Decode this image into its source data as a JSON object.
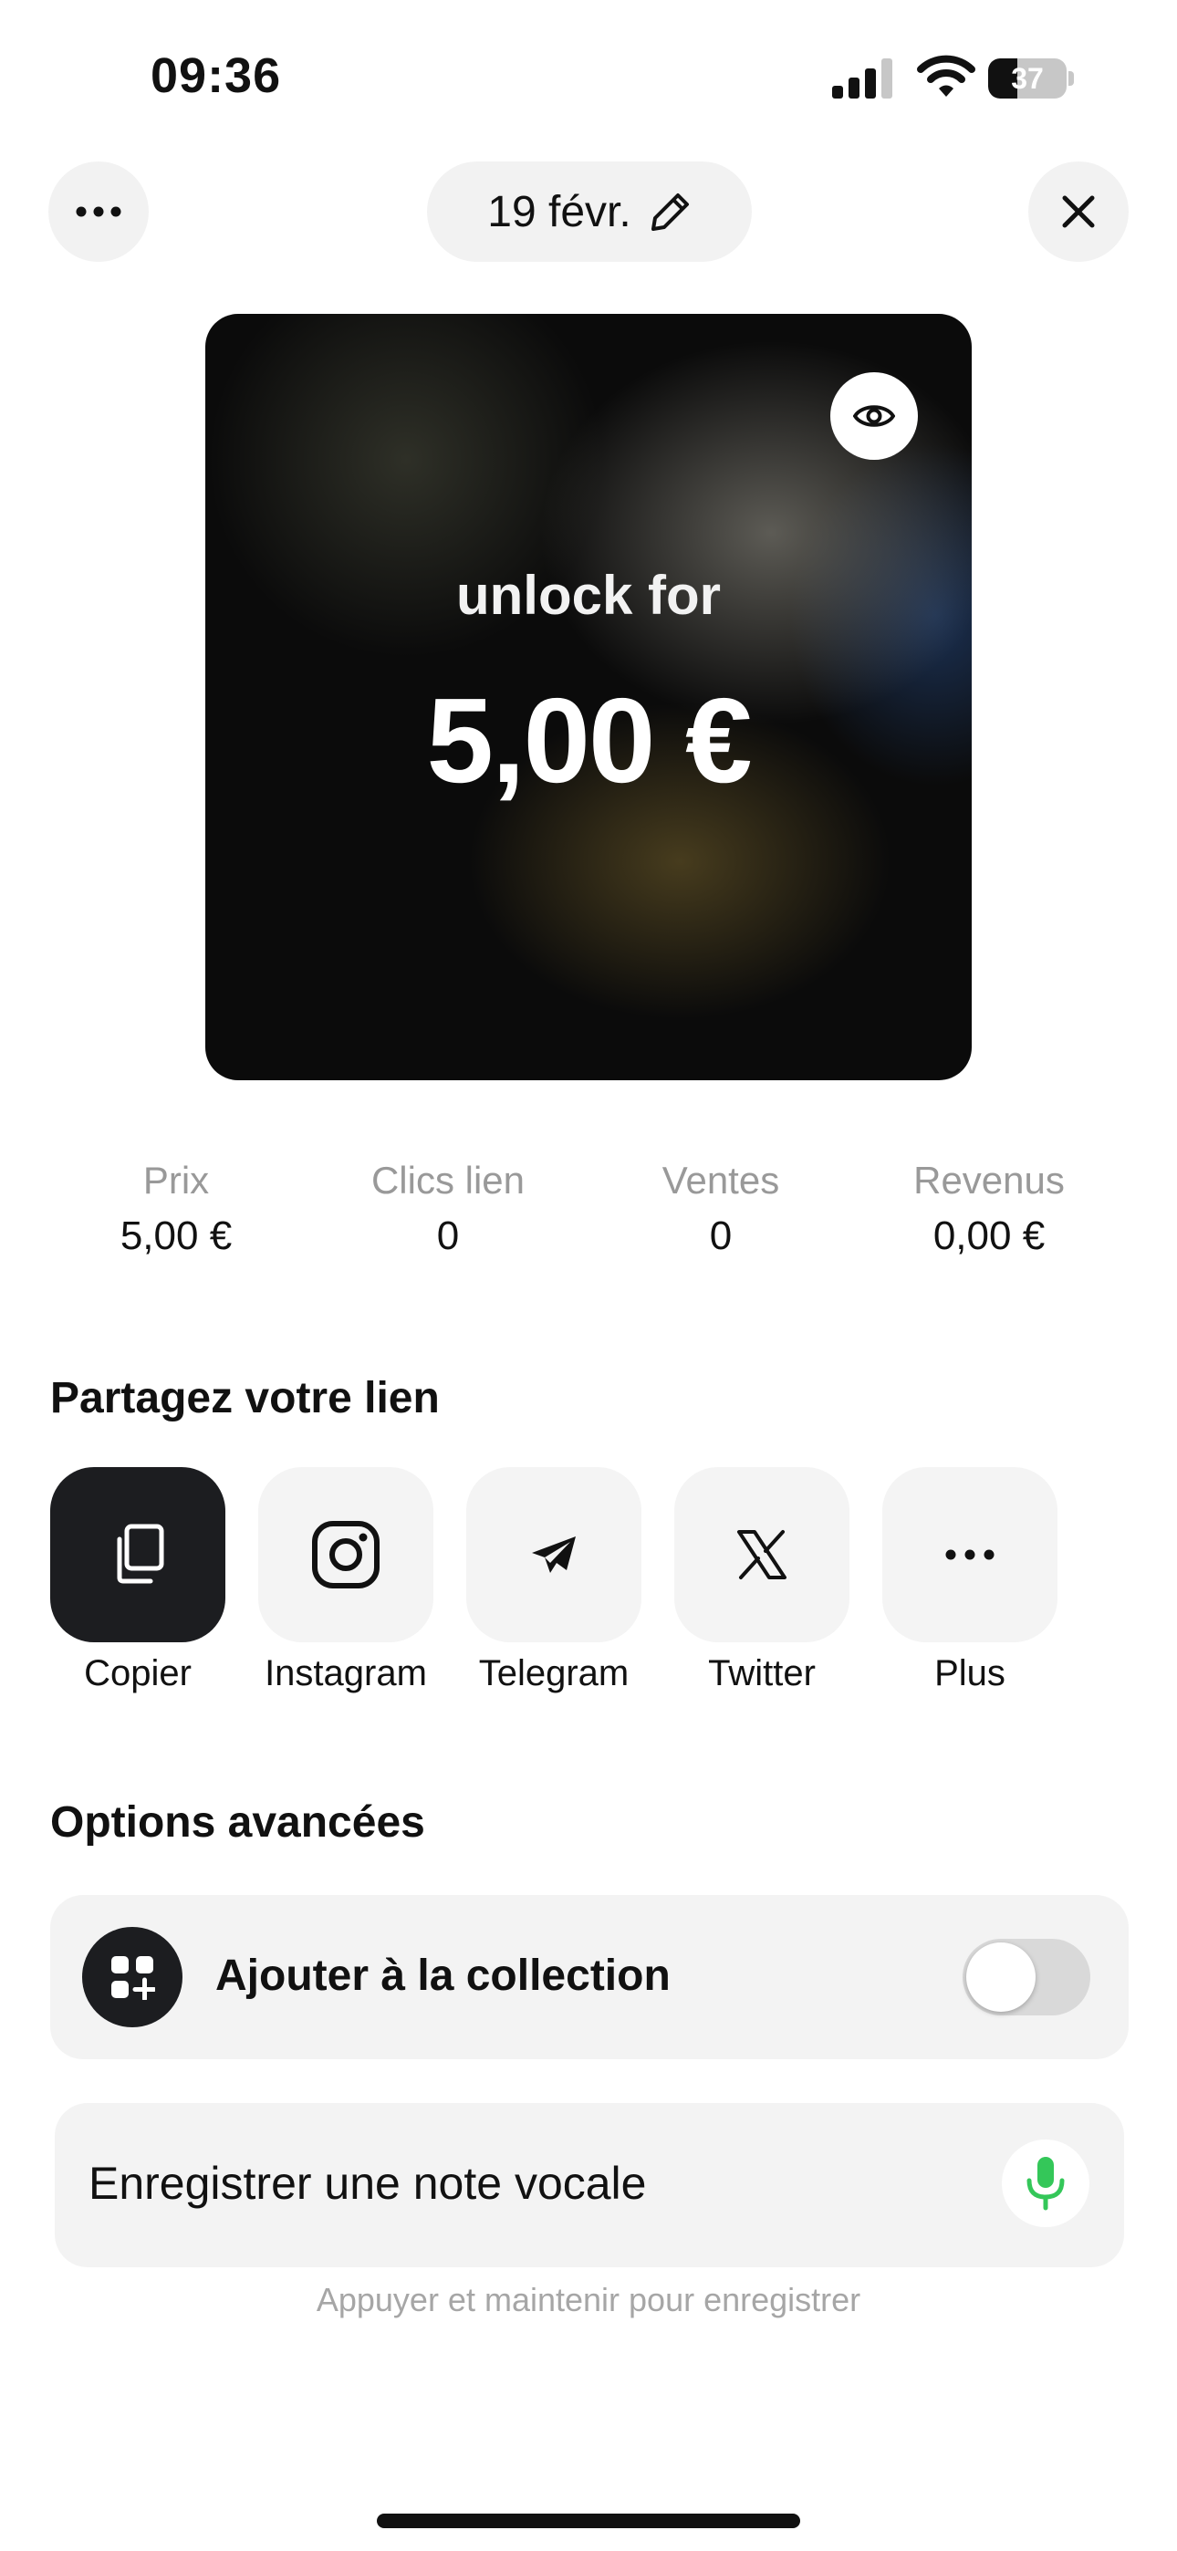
{
  "status_bar": {
    "time": "09:36",
    "battery_level": "37",
    "battery_fraction": 0.37
  },
  "header": {
    "date": "19 févr.",
    "more_icon": "more-icon",
    "edit_icon": "pencil-icon",
    "close_icon": "close-icon"
  },
  "preview": {
    "unlock_label": "unlock for",
    "price": "5,00 €",
    "visibility_icon": "eye-icon"
  },
  "stats": [
    {
      "label": "Prix",
      "value": "5,00 €"
    },
    {
      "label": "Clics lien",
      "value": "0"
    },
    {
      "label": "Ventes",
      "value": "0"
    },
    {
      "label": "Revenus",
      "value": "0,00 €"
    }
  ],
  "share": {
    "title": "Partagez votre lien",
    "items": [
      {
        "label": "Copier",
        "icon": "copy-icon"
      },
      {
        "label": "Instagram",
        "icon": "instagram-icon"
      },
      {
        "label": "Telegram",
        "icon": "telegram-icon"
      },
      {
        "label": "Twitter",
        "icon": "x-icon"
      },
      {
        "label": "Plus",
        "icon": "more-icon"
      }
    ]
  },
  "advanced": {
    "title": "Options avancées",
    "collection_label": "Ajouter à la collection",
    "collection_enabled": false,
    "voice_note_label": "Enregistrer une note vocale",
    "voice_note_hint": "Appuyer et maintenir pour enregistrer"
  },
  "colors": {
    "accent_dark": "#1c1d20",
    "mic_green": "#34c759",
    "muted": "#999999"
  }
}
